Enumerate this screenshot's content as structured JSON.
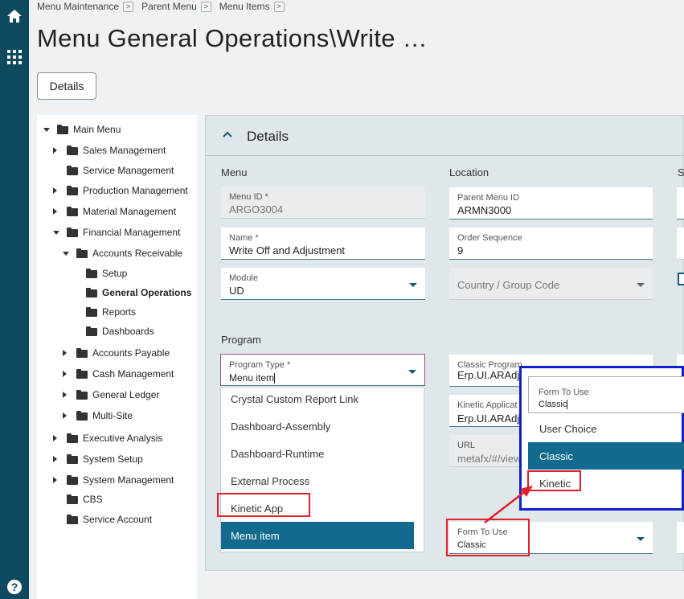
{
  "breadcrumb": [
    "Menu Maintenance",
    "Parent Menu",
    "Menu Items"
  ],
  "page_title": "Menu General Operations\\Write …",
  "details_button": "Details",
  "tree": {
    "items": [
      {
        "label": "Main Menu",
        "arrow": "down",
        "bold": false
      },
      {
        "label": "Sales Management",
        "arrow": "right",
        "bold": false
      },
      {
        "label": "Service Management",
        "arrow": "",
        "bold": false
      },
      {
        "label": "Production Management",
        "arrow": "right",
        "bold": false
      },
      {
        "label": "Material Management",
        "arrow": "right",
        "bold": false
      },
      {
        "label": "Financial Management",
        "arrow": "down",
        "bold": false
      },
      {
        "label": "Accounts Receivable",
        "arrow": "down",
        "bold": false
      },
      {
        "label": "Setup",
        "arrow": "",
        "bold": false
      },
      {
        "label": "General Operations",
        "arrow": "",
        "bold": true
      },
      {
        "label": "Reports",
        "arrow": "",
        "bold": false
      },
      {
        "label": "Dashboards",
        "arrow": "",
        "bold": false
      },
      {
        "label": "Accounts Payable",
        "arrow": "right",
        "bold": false
      },
      {
        "label": "Cash Management",
        "arrow": "right",
        "bold": false
      },
      {
        "label": "General Ledger",
        "arrow": "right",
        "bold": false
      },
      {
        "label": "Multi-Site",
        "arrow": "right",
        "bold": false
      },
      {
        "label": "Executive Analysis",
        "arrow": "right",
        "bold": false
      },
      {
        "label": "System Setup",
        "arrow": "right",
        "bold": false
      },
      {
        "label": "System Management",
        "arrow": "right",
        "bold": false
      },
      {
        "label": "CBS",
        "arrow": "",
        "bold": false
      },
      {
        "label": "Service Account",
        "arrow": "",
        "bold": false
      }
    ]
  },
  "panel": {
    "title": "Details",
    "sections": {
      "menu": "Menu",
      "location": "Location",
      "program": "Program",
      "third_partial": "S"
    },
    "menu_id": {
      "label": "Menu ID *",
      "value": "ARGO3004"
    },
    "name": {
      "label": "Name *",
      "value": "Write Off and Adjustment"
    },
    "module": {
      "label": "Module",
      "value": "UD"
    },
    "parent_menu_id": {
      "label": "Parent Menu ID",
      "value": "ARMN3000"
    },
    "order_sequence": {
      "label": "Order Sequence",
      "value": "9"
    },
    "country_group": {
      "placeholder": "Country / Group Code"
    },
    "program_type": {
      "label": "Program Type *",
      "value": "Menu item"
    },
    "program_type_options": [
      "Crystal Custom Report Link",
      "Dashboard-Assembly",
      "Dashboard-Runtime",
      "External Process",
      "Kinetic App",
      "Menu item"
    ],
    "program_type_selected": "Menu item",
    "classic_program": {
      "label": "Classic Program",
      "value": "Erp.UI.ARAdju"
    },
    "kinetic_application": {
      "label": "Kinetic Applicat",
      "value": "Erp.UI.ARAdju"
    },
    "url": {
      "label": "URL",
      "value": "metafx/#/view"
    },
    "form_to_use": {
      "label": "Form To Use",
      "value": "Classic"
    }
  },
  "form_to_use_popup": {
    "label": "Form To Use",
    "value": "Classic",
    "options": [
      "User Choice",
      "Classic",
      "Kinetic"
    ],
    "selected": "Classic"
  },
  "colors": {
    "rail": "#0f4a5e",
    "accent": "#136a8f",
    "highlight_red": "#e0202a",
    "highlight_blue": "#1020c8"
  }
}
